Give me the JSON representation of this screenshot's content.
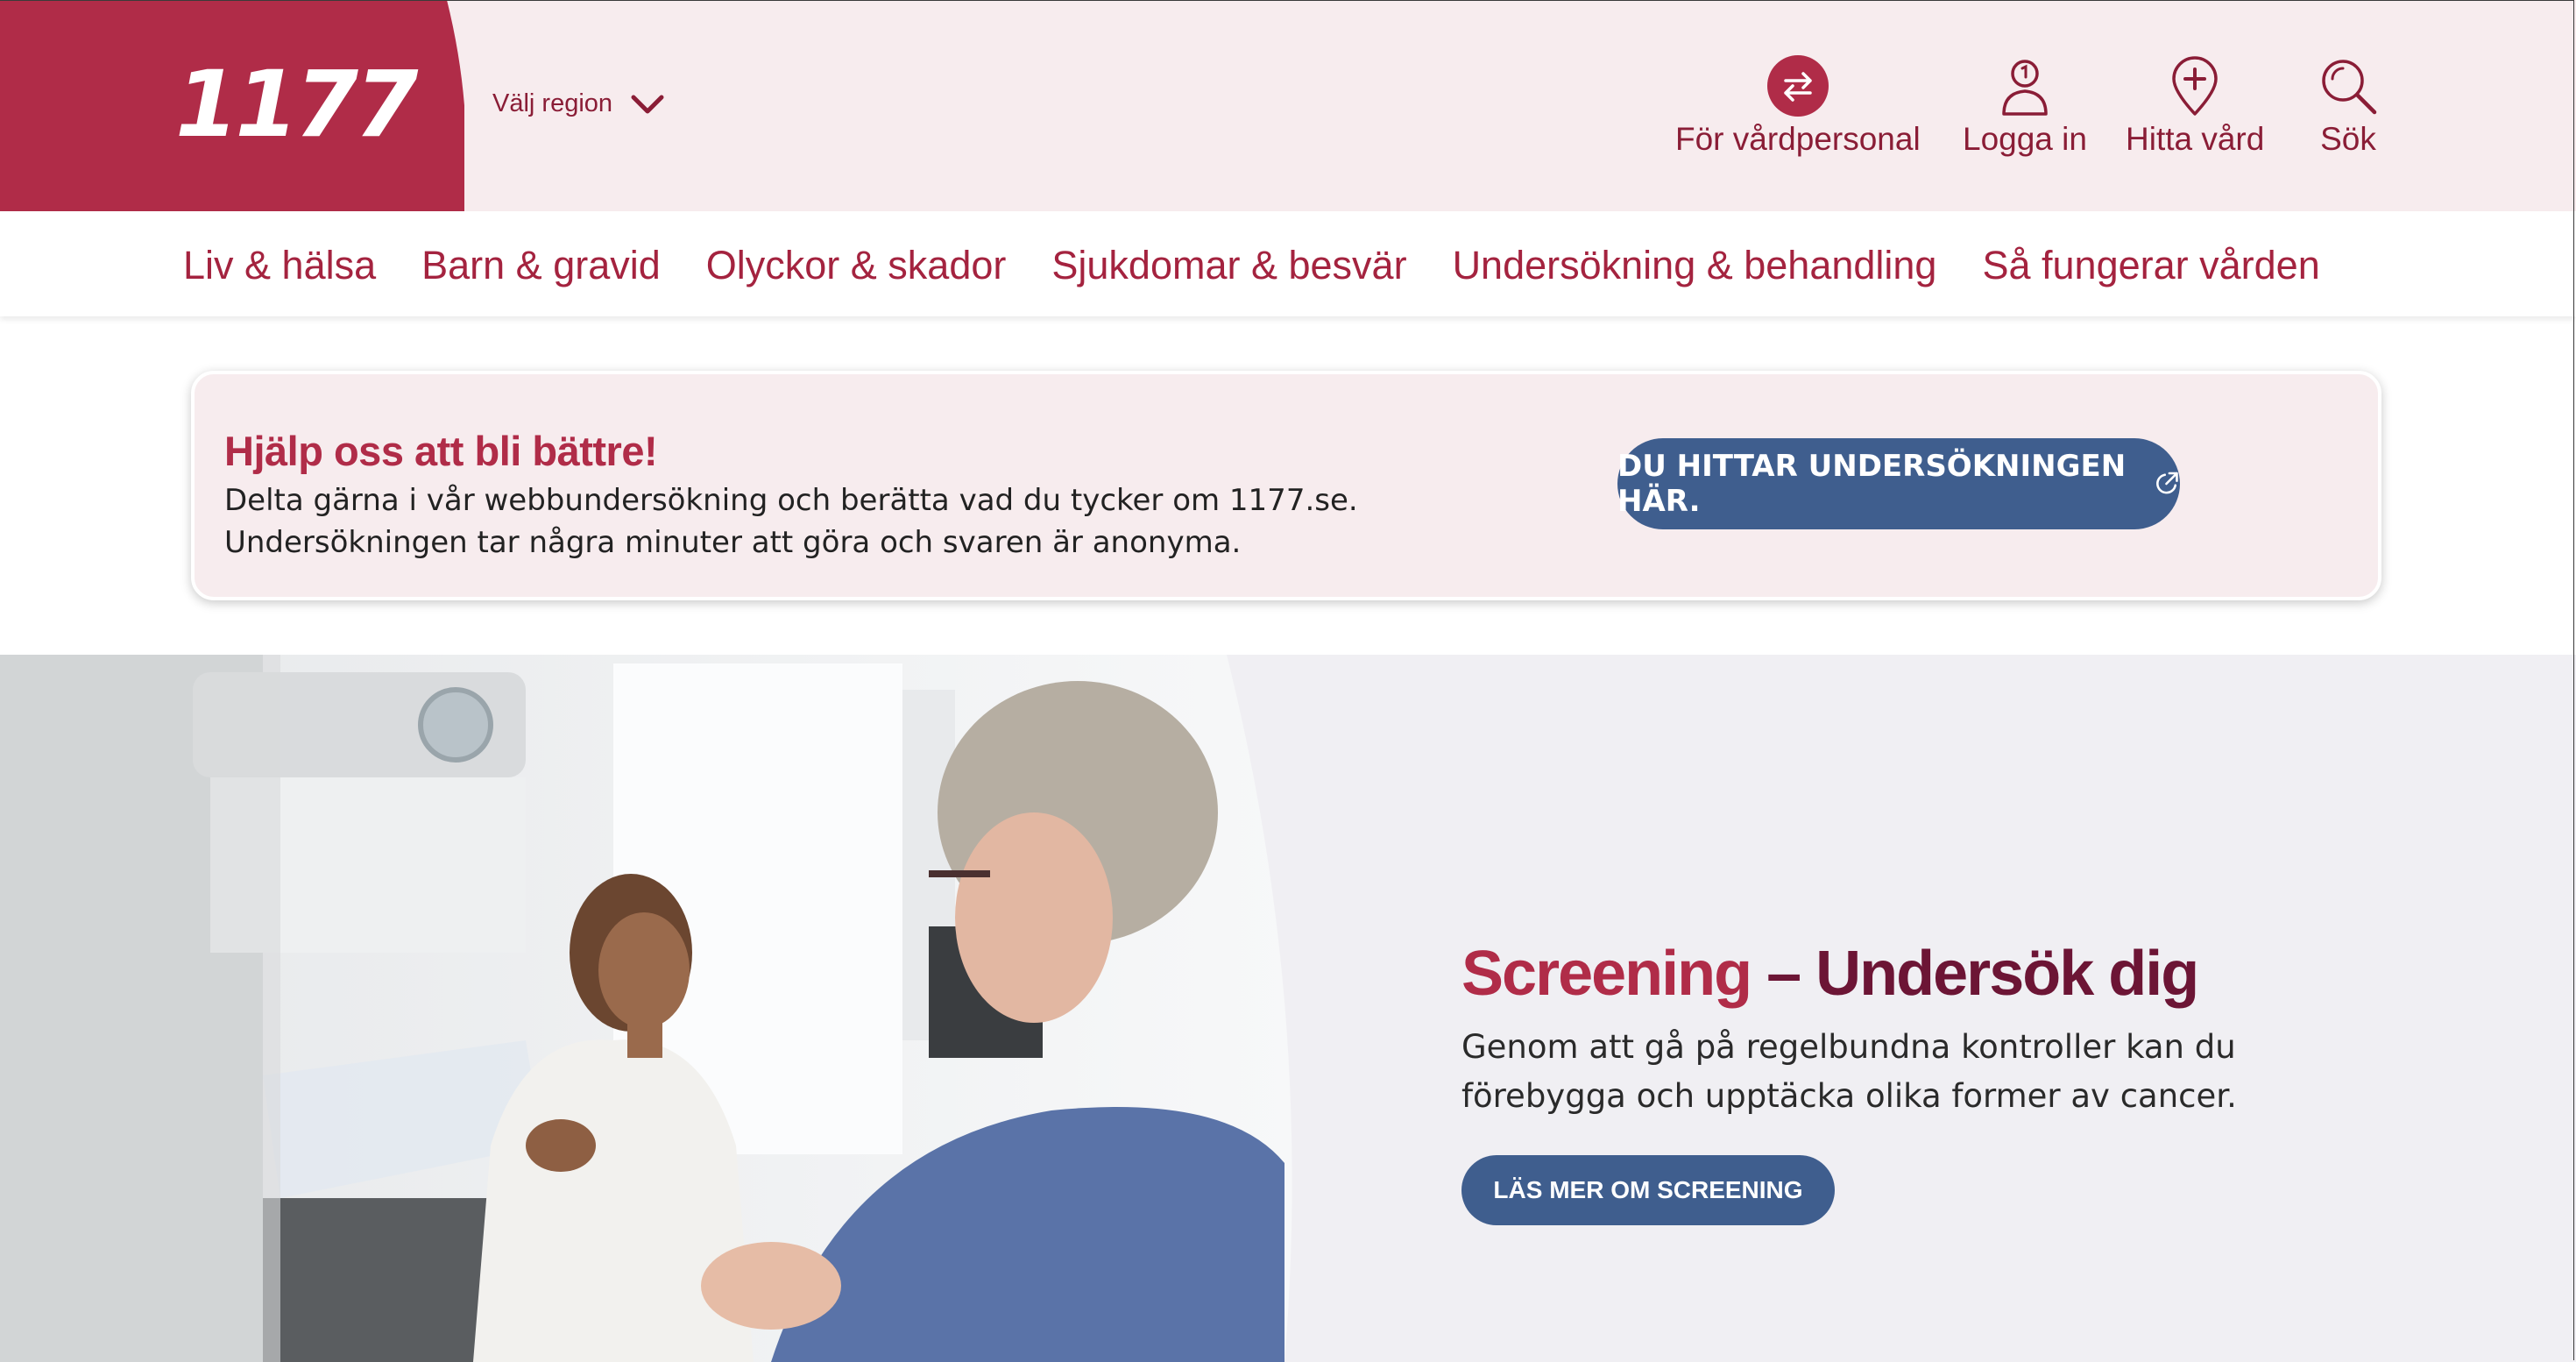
{
  "header": {
    "logo_text": "1177",
    "region_label": "Välj region",
    "utility": [
      {
        "label": "För vårdpersonal",
        "icon": "swap-arrows-icon"
      },
      {
        "label": "Logga in",
        "icon": "user-icon"
      },
      {
        "label": "Hitta vård",
        "icon": "location-pin-plus-icon"
      },
      {
        "label": "Sök",
        "icon": "search-icon"
      }
    ]
  },
  "nav": {
    "items": [
      "Liv & hälsa",
      "Barn & gravid",
      "Olyckor & skador",
      "Sjukdomar & besvär",
      "Undersökning & behandling",
      "Så fungerar vården"
    ]
  },
  "survey": {
    "title": "Hjälp oss att bli bättre!",
    "line1": "Delta gärna i vår webbundersökning och berätta vad du tycker om 1177.se.",
    "line2": "Undersökningen tar några minuter att göra och svaren är anonyma.",
    "button_label": "DU HITTAR UNDERSÖKNINGEN HÄR.",
    "button_icon": "external-link-icon"
  },
  "hero": {
    "title_accent": "Screening",
    "title_rest": " – Undersök dig",
    "text": "Genom att gå på regelbundna kontroller kan du förebygga och upptäcka olika former av cancer.",
    "button_label": "LÄS MER OM SCREENING"
  },
  "colors": {
    "brand_red": "#b02c48",
    "brand_dark_red": "#8a1d36",
    "header_bg": "#f7ecee",
    "button_blue": "#3f5e8e",
    "hero_bg": "#f0eff3"
  }
}
